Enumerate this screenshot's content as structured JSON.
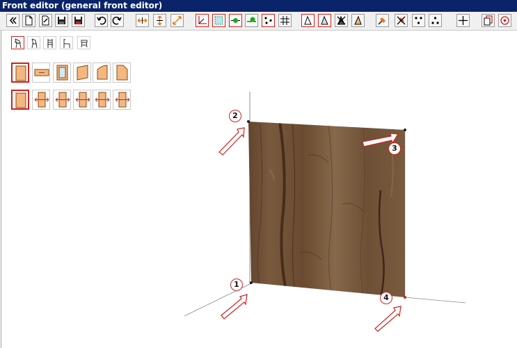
{
  "window": {
    "title": "Front editor (general front editor)"
  },
  "toolbar": {
    "buttons": [
      {
        "name": "collapse-icon"
      },
      {
        "name": "new-document-icon"
      },
      {
        "name": "edit-document-icon"
      },
      {
        "name": "save-icon"
      },
      {
        "name": "save-as-icon"
      },
      {
        "name": "undo-icon"
      },
      {
        "name": "redo-icon"
      },
      {
        "name": "resize-horizontal-icon"
      },
      {
        "name": "resize-vertical-icon"
      },
      {
        "name": "resize-diagonal-icon"
      },
      {
        "name": "axis-corner-icon"
      },
      {
        "name": "select-area-icon"
      },
      {
        "name": "point-green-icon"
      },
      {
        "name": "point-green-move-icon"
      },
      {
        "name": "four-points-icon"
      },
      {
        "name": "grid-point-icon"
      },
      {
        "name": "triangle-outline-icon"
      },
      {
        "name": "triangle-filled-icon"
      },
      {
        "name": "triangle-cross-icon"
      },
      {
        "name": "triangle-orange-icon"
      },
      {
        "name": "pin-orange-icon"
      },
      {
        "name": "pin-cross-icon"
      },
      {
        "name": "three-dots-icon"
      },
      {
        "name": "three-dots-alt-icon"
      },
      {
        "name": "crosshair-icon"
      },
      {
        "name": "copy-red-icon"
      },
      {
        "name": "target-icon"
      }
    ]
  },
  "palette": {
    "chairs": [
      "chair-1-icon",
      "chair-2-icon",
      "chair-3-icon",
      "chair-4-icon",
      "stool-icon"
    ],
    "fronts_row1": [
      "front-door-icon",
      "front-drawer-icon",
      "front-glass-icon",
      "front-slanted-icon",
      "front-curved-icon",
      "front-folded-icon"
    ],
    "fronts_row2": [
      "front-plain-icon",
      "front-hinge-left-icon",
      "front-hinge-right-icon",
      "front-hinge-both-icon",
      "front-hinge-double-icon",
      "front-hinge-top-icon"
    ]
  },
  "viewport": {
    "panel_material": "wood-oak",
    "colors": {
      "wood_dark": "#4a3220",
      "wood_mid": "#6b4c32",
      "wood_light": "#8a6a4a",
      "accent": "#d02020"
    },
    "callouts": [
      {
        "label": "1"
      },
      {
        "label": "2"
      },
      {
        "label": "3"
      },
      {
        "label": "4"
      }
    ]
  }
}
